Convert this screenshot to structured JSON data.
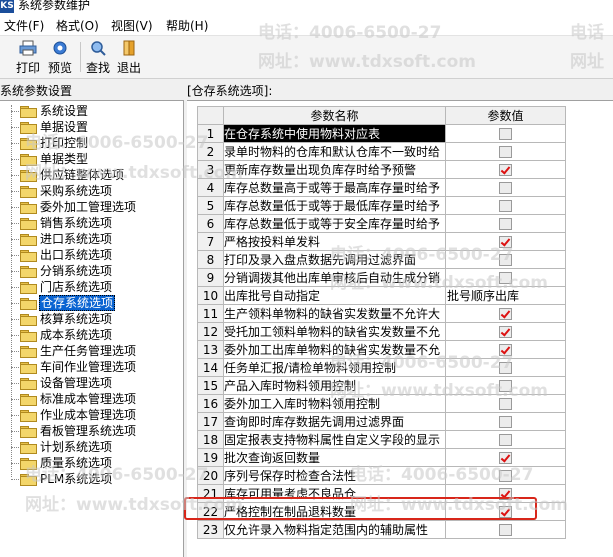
{
  "window": {
    "title": "系统参数维护",
    "icon_text": "KS"
  },
  "menu": [
    {
      "label": "文件(F)"
    },
    {
      "label": "格式(O)"
    },
    {
      "label": "视图(V)"
    },
    {
      "label": "帮助(H)"
    }
  ],
  "toolbar": {
    "print_label": "打印",
    "preview_label": "预览",
    "find_label": "查找",
    "exit_label": "退出"
  },
  "left_panel": {
    "header": "系统参数设置",
    "items": [
      {
        "label": "系统设置"
      },
      {
        "label": "单据设置"
      },
      {
        "label": "打印控制"
      },
      {
        "label": "单据类型"
      },
      {
        "label": "供应链整体选项"
      },
      {
        "label": "采购系统选项"
      },
      {
        "label": "委外加工管理选项"
      },
      {
        "label": "销售系统选项"
      },
      {
        "label": "进口系统选项"
      },
      {
        "label": "出口系统选项"
      },
      {
        "label": "分销系统选项"
      },
      {
        "label": "门店系统选项"
      },
      {
        "label": "仓存系统选项"
      },
      {
        "label": "核算系统选项"
      },
      {
        "label": "成本系统选项"
      },
      {
        "label": "生产任务管理选项"
      },
      {
        "label": "车间作业管理选项"
      },
      {
        "label": "设备管理选项"
      },
      {
        "label": "标准成本管理选项"
      },
      {
        "label": "作业成本管理选项"
      },
      {
        "label": "看板管理系统选项"
      },
      {
        "label": "计划系统选项"
      },
      {
        "label": "质量系统选项"
      },
      {
        "label": "PLM系统选项"
      }
    ],
    "selected_index": 12
  },
  "right_panel": {
    "header": "[仓存系统选项]:",
    "columns": {
      "name": "参数名称",
      "value": "参数值"
    },
    "rows": [
      {
        "num": "1",
        "name": "在仓存系统中使用物料对应表",
        "checked": false
      },
      {
        "num": "2",
        "name": "录单时物料的仓库和默认仓库不一致时给",
        "checked": false
      },
      {
        "num": "3",
        "name": "更新库存数量出现负库存时给予预警",
        "checked": true
      },
      {
        "num": "4",
        "name": "库存总数量高于或等于最高库存量时给予",
        "checked": false
      },
      {
        "num": "5",
        "name": "库存总数量低于或等于最低库存量时给予",
        "checked": false
      },
      {
        "num": "6",
        "name": "库存总数量低于或等于安全库存量时给予",
        "checked": false
      },
      {
        "num": "7",
        "name": "严格按投料单发料",
        "checked": true
      },
      {
        "num": "8",
        "name": "打印及录入盘点数据先调用过滤界面",
        "checked": false
      },
      {
        "num": "9",
        "name": "分销调拨其他出库单审核后自动生成分销",
        "checked": false
      },
      {
        "num": "10",
        "name": "出库批号自动指定",
        "text": "批号顺序出库"
      },
      {
        "num": "11",
        "name": "生产领料单物料的缺省实发数量不允许大",
        "checked": true
      },
      {
        "num": "12",
        "name": "受托加工领料单物料的缺省实发数量不允",
        "checked": true
      },
      {
        "num": "13",
        "name": "委外加工出库单物料的缺省实发数量不允",
        "checked": true
      },
      {
        "num": "14",
        "name": "任务单汇报/请检单物料领用控制",
        "checked": false
      },
      {
        "num": "15",
        "name": "产品入库时物料领用控制",
        "checked": false
      },
      {
        "num": "16",
        "name": "委外加工入库时物料领用控制",
        "checked": false
      },
      {
        "num": "17",
        "name": "查询即时库存数据先调用过滤界面",
        "checked": false
      },
      {
        "num": "18",
        "name": "固定报表支持物料属性自定义字段的显示",
        "checked": false
      },
      {
        "num": "19",
        "name": "批次查询返回数量",
        "checked": true
      },
      {
        "num": "20",
        "name": "序列号保存时检查合法性",
        "checked": false
      },
      {
        "num": "21",
        "name": "库存可用量考虑不良品仓",
        "checked": true
      },
      {
        "num": "22",
        "name": "严格控制在制品退料数量",
        "checked": true
      },
      {
        "num": "23",
        "name": "仅允许录入物料指定范围内的辅助属性",
        "checked": false
      }
    ],
    "selected_row": 0,
    "highlight_row": 21
  },
  "watermark": {
    "phone": "电话：4006-6500-27",
    "site": "网址：www.tdxsoft.com",
    "phone_label": "电话",
    "site_label": "网址"
  }
}
